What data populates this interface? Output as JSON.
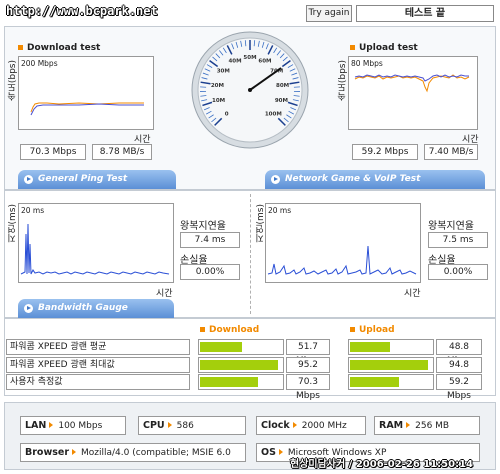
{
  "header": {
    "url_watermark": "http://www.bcpark.net",
    "try_again_label": "Try again",
    "status_text": "테스트 끝"
  },
  "download": {
    "title": "Download test",
    "axis_y_label": "속도(bps)",
    "scale_label": "200 Mbps",
    "time_label": "시간",
    "mbps": "70.3 Mbps",
    "mbs": "8.78 MB/s"
  },
  "upload": {
    "title": "Upload test",
    "axis_y_label": "속도(bps)",
    "scale_label": "80 Mbps",
    "time_label": "시간",
    "mbps": "59.2 Mbps",
    "mbs": "7.40 MB/s"
  },
  "gauge": {
    "ticks": [
      "0",
      "10M",
      "20M",
      "30M",
      "40M",
      "50M",
      "60M",
      "70M",
      "80M",
      "90M",
      "100M"
    ],
    "needle_value": 70.3,
    "needle_max": 100
  },
  "ping_tab_label": "General Ping Test",
  "game_tab_label": "Network Game & VoIP Test",
  "ping": {
    "axis_y_label": "지연(ms)",
    "scale_label": "20 ms",
    "time_label": "시간",
    "rtt_label": "왕복지연율",
    "rtt_value": "7.4 ms",
    "loss_label": "손실율",
    "loss_value": "0.00%"
  },
  "game": {
    "axis_y_label": "지연(ms)",
    "scale_label": "20 ms",
    "time_label": "시간",
    "rtt_label": "왕복지연율",
    "rtt_value": "7.5 ms",
    "loss_label": "손실율",
    "loss_value": "0.00%"
  },
  "bandwidth_tab_label": "Bandwidth Gauge",
  "bandwidth": {
    "download_header": "Download",
    "upload_header": "Upload",
    "rows": [
      {
        "label": "파워콤 XPEED 광랜 평균",
        "down": "51.7 Mbps",
        "down_frac": 0.517,
        "up": "48.8 Mbps",
        "up_frac": 0.488
      },
      {
        "label": "파워콤 XPEED 광랜 최대값",
        "down": "95.2 Mbps",
        "down_frac": 0.952,
        "up": "94.8 Mbps",
        "up_frac": 0.948
      },
      {
        "label": "사용자 측정값",
        "down": "70.3 Mbps",
        "down_frac": 0.703,
        "up": "59.2 Mbps",
        "up_frac": 0.592
      }
    ]
  },
  "sysinfo": {
    "lan_label": "LAN",
    "lan_value": "100 Mbps",
    "cpu_label": "CPU",
    "cpu_value": "586",
    "clock_label": "Clock",
    "clock_value": "2000 MHz",
    "ram_label": "RAM",
    "ram_value": "256 MB",
    "browser_label": "Browser",
    "browser_value": "Mozilla/4.0 (compatible; MSIE 6.0",
    "os_label": "OS",
    "os_value": "Microsoft Windows XP"
  },
  "footer_watermark": "현상미담사커 / 2006-02-26 11:50:14",
  "colors": {
    "accent_orange": "#f28a00",
    "tab_blue": "#5b8fd6",
    "bar_green": "#a4cf0c",
    "ping_blue": "#2a4fd6"
  }
}
